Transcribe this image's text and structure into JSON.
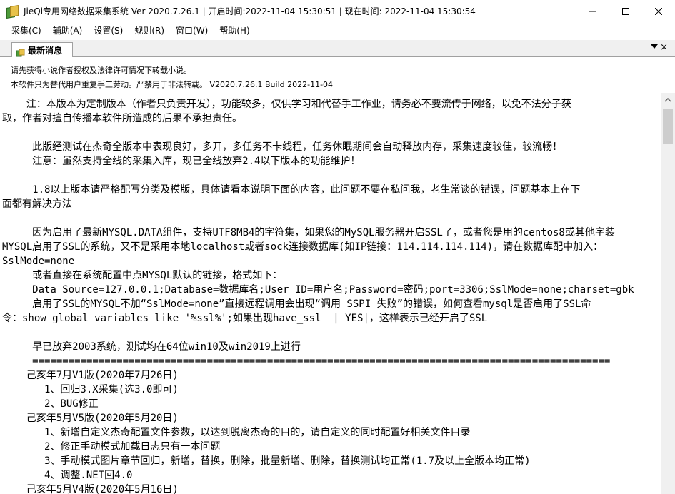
{
  "window": {
    "title": "JieQi专用网络数据采集系统 Ver 2020.7.26.1 | 开启时间:2022-11-04 15:30:51 | 现在时间: 2022-11-04 15:30:54",
    "minimize_icon": "minimize-icon",
    "maximize_icon": "maximize-icon",
    "close_icon": "close-icon"
  },
  "menu": {
    "items": [
      "采集(C)",
      "辅助(A)",
      "设置(S)",
      "规则(R)",
      "窗口(W)",
      "帮助(H)"
    ]
  },
  "tab": {
    "label": "最新消息",
    "close": "×"
  },
  "notices": {
    "line1": "请先获得小说作者授权及法律许可情况下转载小说。",
    "line2": "本软件只为替代用户重复手工劳动。严禁用于非法转载。  V2020.7.26.1 Build 2022-11-04"
  },
  "content_lines": [
    "    注：本版本为定制版本（作者只负责开发），功能较多，仅供学习和代替手工作业，请务必不要流传于网络，以免不法分子获",
    "取，作者对擅自传播本软件所造成的后果不承担责任。",
    "",
    "     此版经测试在杰奇全版本中表现良好，多开，多任务不卡线程，任务休眠期间会自动释放内存，采集速度较佳，较流畅！",
    "     注意：虽然支持全线的采集入库，现已全线放弃2.4以下版本的功能维护！",
    "",
    "     1.8以上版本请严格配写分类及模版，具体请看本说明下面的内容，此问题不要在私问我，老生常谈的错误，问题基本上在下",
    "面都有解决方法",
    "",
    "     因为启用了最新MYSQL.DATA组件，支持UTF8MB4的字符集，如果您的MySQL服务器开启SSL了，或者您是用的centos8或其他字装",
    "MYSQL启用了SSL的系统，又不是采用本地localhost或者sock连接数据库(如IP链接：114.114.114.114)，请在数据库配中加入：",
    "SslMode=none",
    "     或者直接在系统配置中点MYSQL默认的链接，格式如下：",
    "     Data Source=127.0.0.1;Database=数据库名;User ID=用户名;Password=密码;port=3306;SslMode=none;charset=gbk",
    "     启用了SSL的MYSQL不加“SslMode=none”直接远程调用会出现“调用 SSPI 失败”的错误，如何查看mysql是否启用了SSL命",
    "令：show global variables like '%ssl%';如果出现have_ssl  | YES|，这样表示已经开启了SSL",
    "",
    "     早已放弃2003系统，测试均在64位win10及win2019上进行",
    "     ================================================================================================",
    "    己亥年7月V1版(2020年7月26日)",
    "       1、回归3.X采集(选3.0即可)",
    "       2、BUG修正",
    "    己亥年5月V5版(2020年5月20日)",
    "       1、新增自定义杰奇配置文件参数，以达到脱离杰奇的目的，请自定义的同时配置好相关文件目录",
    "       2、修正手动模式加载日志只有一本问题",
    "       3、手动模式图片章节回归，新增，替换，删除，批量新增、删除，替换测试均正常(1.7及以上全版本均正常)",
    "       4、调整.NET回4.0",
    "    己亥年5月V4版(2020年5月16日)"
  ]
}
